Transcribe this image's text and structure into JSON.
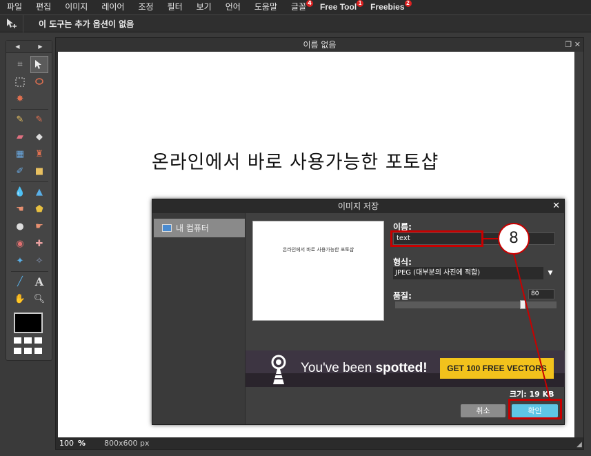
{
  "menubar": {
    "items": [
      {
        "label": "파일"
      },
      {
        "label": "편집"
      },
      {
        "label": "이미지"
      },
      {
        "label": "레이어"
      },
      {
        "label": "조정"
      },
      {
        "label": "필터"
      },
      {
        "label": "보기"
      },
      {
        "label": "언어"
      },
      {
        "label": "도움말"
      },
      {
        "label": "글꼴",
        "badge": "4"
      },
      {
        "label": "Free Tool",
        "badge": "1"
      },
      {
        "label": "Freebies",
        "badge": "2"
      }
    ]
  },
  "options_bar": {
    "message": "이 도구는 추가 옵션이 없음"
  },
  "document": {
    "title": "이름 없음",
    "canvas_text": "온라인에서 바로 사용가능한 포토샵",
    "zoom": "100",
    "zoom_unit": "%",
    "canvas_size": "800x600 px"
  },
  "dialog": {
    "title": "이미지 저장",
    "location": "내 컴퓨터",
    "preview_text": "온라인에서 바로 사용가능한 포토샵",
    "name_label": "이름:",
    "name_value": "text",
    "format_label": "형식:",
    "format_value": "JPEG (대부분의 사진에 적합)",
    "quality_label": "품질:",
    "quality_value": "80",
    "quality_level": 0.8,
    "size_label": "크기: 19 KB",
    "cancel_label": "취소",
    "ok_label": "확인"
  },
  "ad": {
    "text_plain": "You've been ",
    "text_bold": "spotted!",
    "cta": "GET 100 FREE VECTORS"
  },
  "annotation": {
    "step_number": "8",
    "color": "#c80000"
  },
  "colors": {
    "ok_button": "#5ec6e6",
    "ad_cta": "#f2c21c",
    "foreground": "#000000"
  }
}
